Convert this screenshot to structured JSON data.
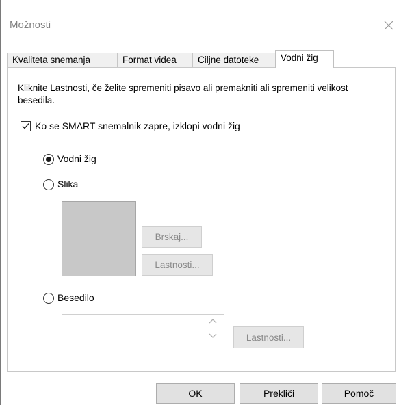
{
  "window": {
    "title": "Možnosti"
  },
  "tabs": [
    {
      "label": "Kvaliteta snemanja"
    },
    {
      "label": "Format videa"
    },
    {
      "label": "Ciljne datoteke"
    },
    {
      "label": "Vodni žig",
      "active": true
    }
  ],
  "panel": {
    "description": "Kliknite Lastnosti, če želite spremeniti pisavo ali premakniti ali spremeniti velikost besedila.",
    "checkbox": {
      "label": "Ko se SMART snemalnik zapre, izklopi vodni žig",
      "checked": true
    },
    "radios": {
      "watermark": {
        "label": "Vodni žig",
        "selected": true
      },
      "image": {
        "label": "Slika",
        "selected": false
      },
      "text": {
        "label": "Besedilo",
        "selected": false
      }
    },
    "image_section": {
      "browse_label": "Brskaj...",
      "properties_label": "Lastnosti..."
    },
    "text_section": {
      "value": "",
      "properties_label": "Lastnosti..."
    }
  },
  "footer": {
    "ok_label": "OK",
    "cancel_label": "Prekliči",
    "help_label": "Pomoč"
  },
  "colors": {
    "disabled_text": "#8a8a8a",
    "disabled_button": "#e6e6e6",
    "preview_fill": "#c8c8c8"
  },
  "icons": {
    "close": "close-icon",
    "checkmark": "checkmark-icon",
    "scroll_up": "chevron-up-icon",
    "scroll_down": "chevron-down-icon"
  }
}
